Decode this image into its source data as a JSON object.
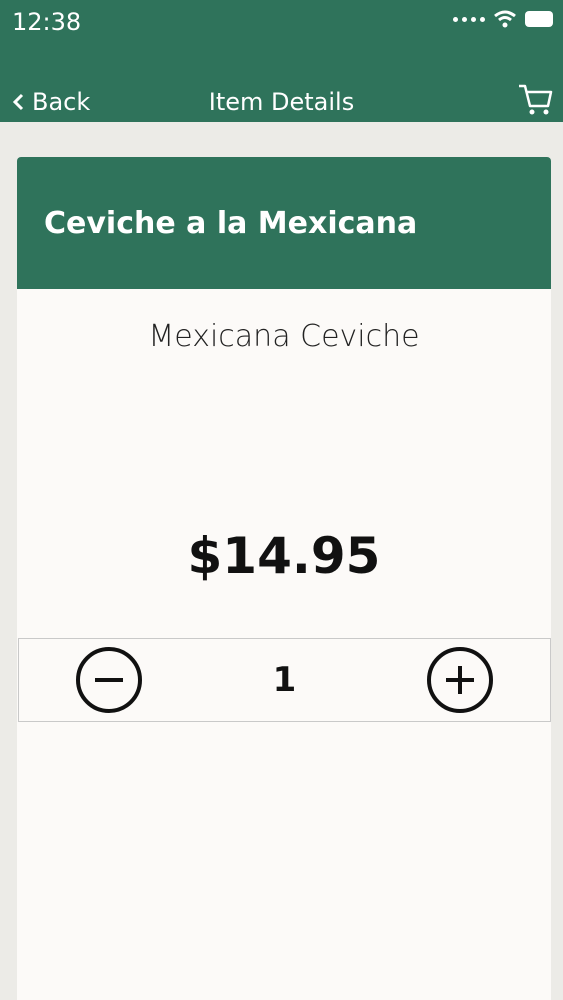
{
  "status_bar": {
    "time": "12:38"
  },
  "nav": {
    "back_label": "Back",
    "title": "Item Details"
  },
  "item": {
    "name": "Ceviche a la Mexicana",
    "subtitle": "Mexicana Ceviche",
    "price": "$14.95",
    "quantity": "1"
  },
  "colors": {
    "brand": "#2f735b",
    "card_bg": "#fcfaf8",
    "page_bg": "#ecebe7"
  },
  "icons": [
    "chevron-left-icon",
    "cart-icon",
    "minus-circle-icon",
    "plus-circle-icon",
    "wifi-icon",
    "battery-icon",
    "signal-dots-icon"
  ]
}
